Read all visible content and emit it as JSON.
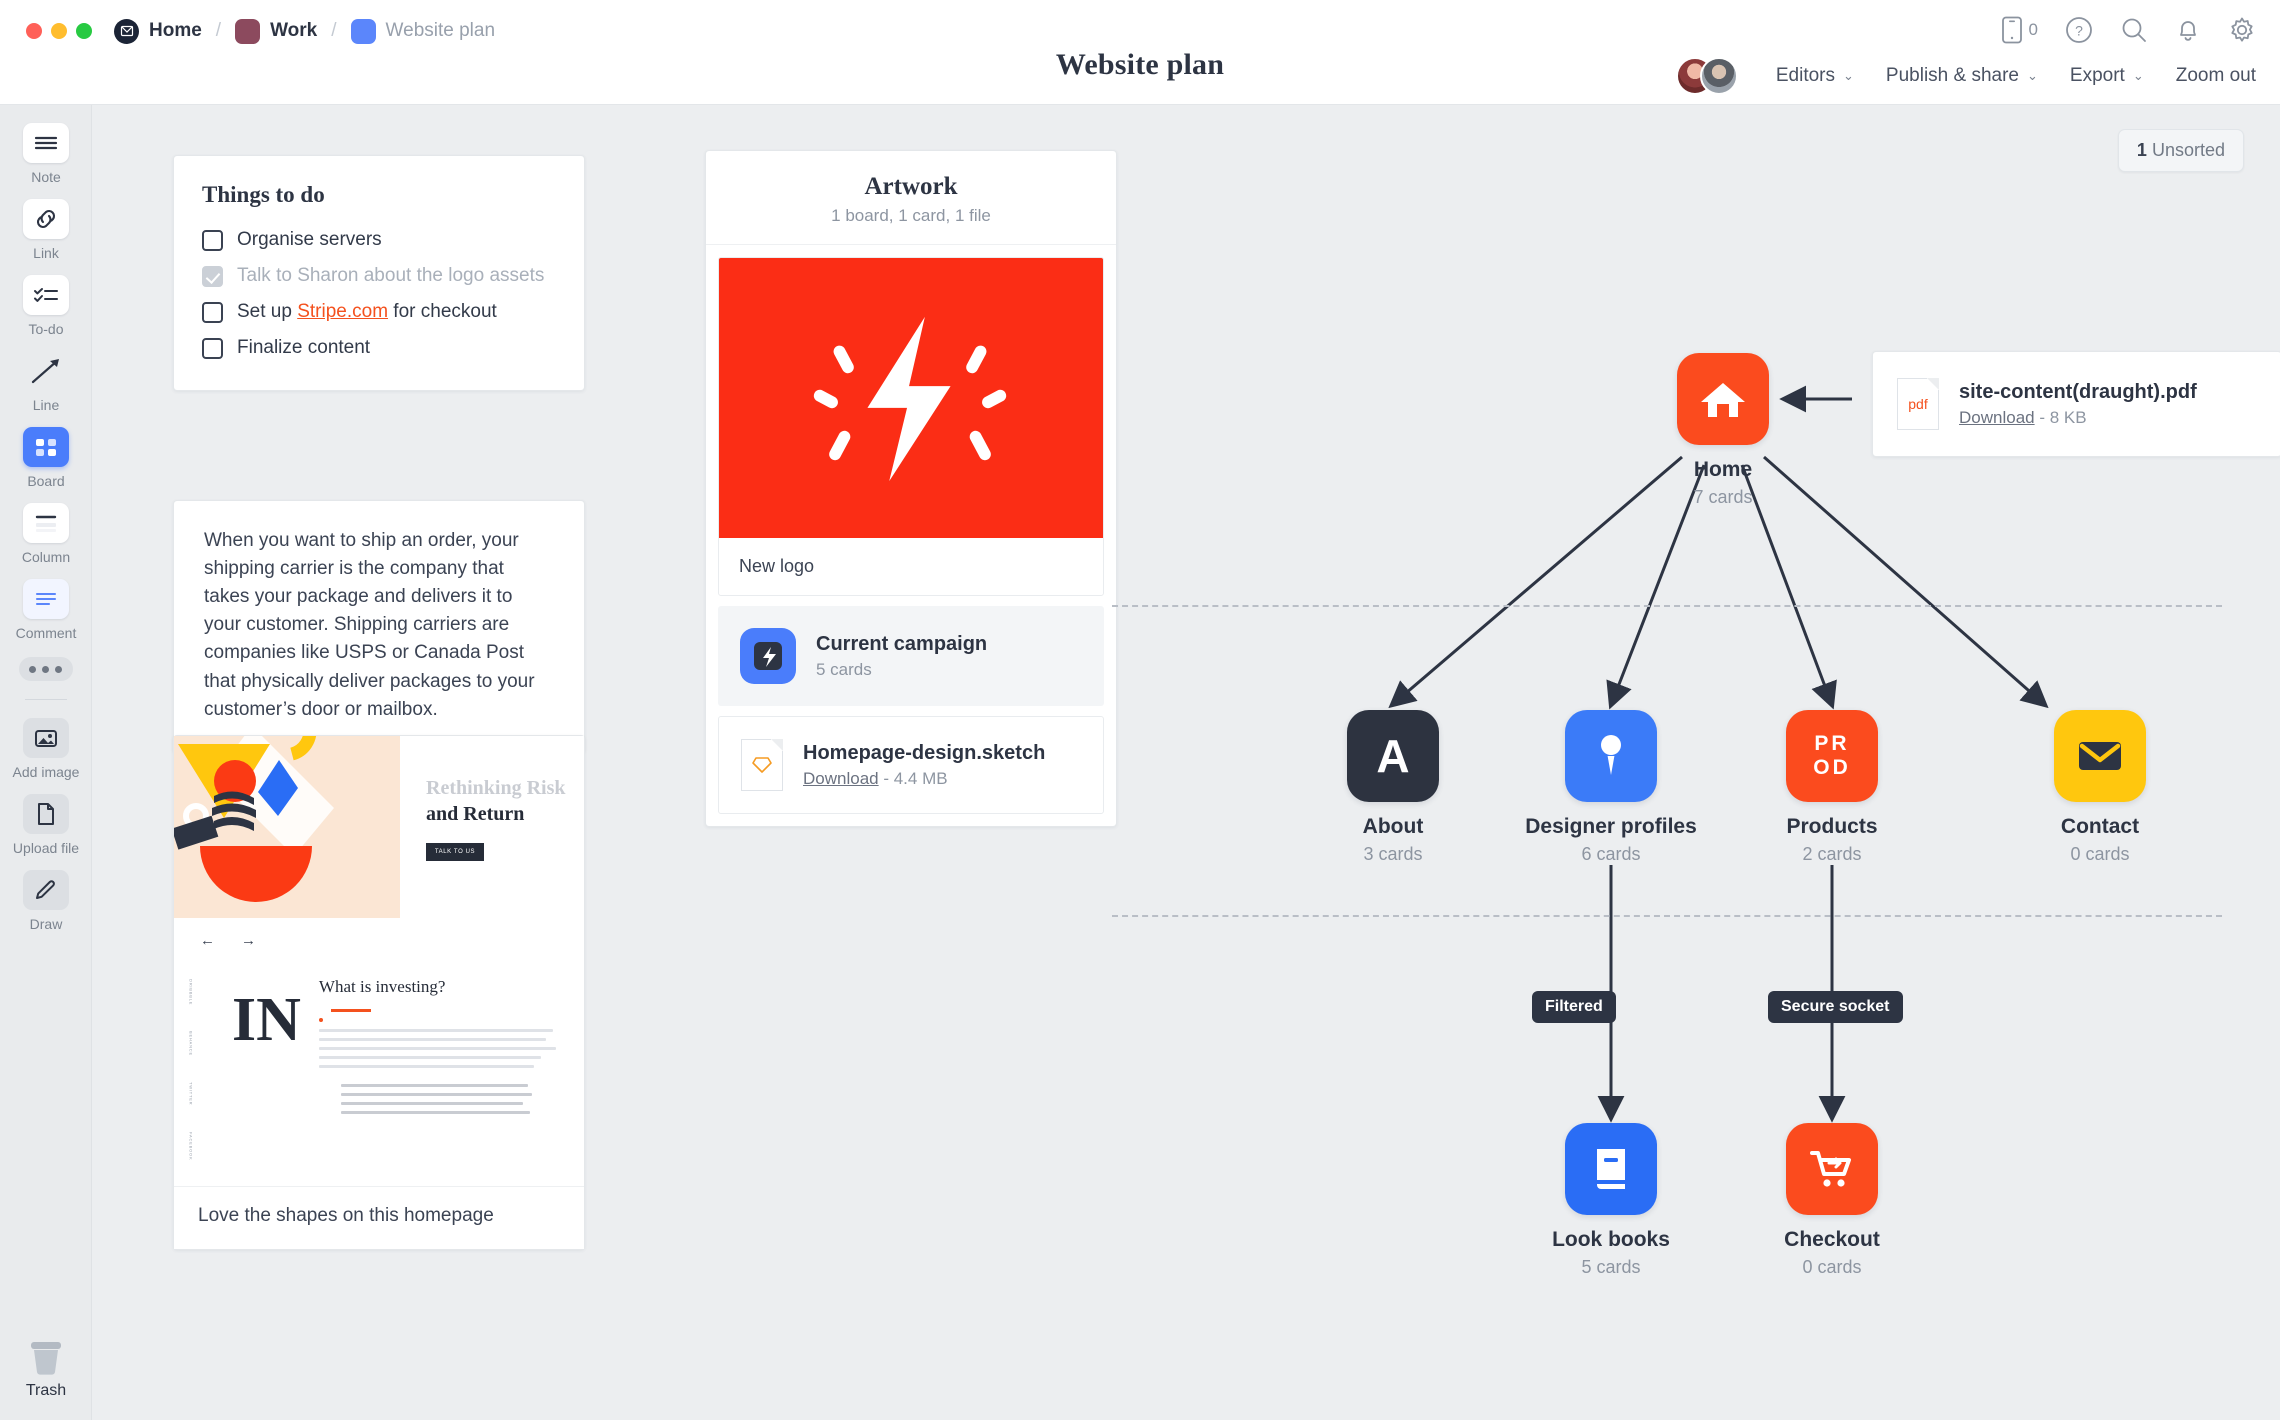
{
  "window": {
    "traffic_lights": [
      "close",
      "minimize",
      "zoom"
    ],
    "breadcrumb": [
      {
        "label": "Home",
        "icon": "milanote-logo-icon",
        "color": "#1b2436"
      },
      {
        "label": "Work",
        "icon": "color-swatch-icon",
        "color": "#8c4a5e"
      },
      {
        "label": "Website plan",
        "icon": "color-swatch-icon",
        "color": "#5b86fb"
      }
    ],
    "separator": "/",
    "title": "Website plan"
  },
  "topbar_icons": [
    {
      "name": "mobile-device-icon",
      "badge": "0"
    },
    {
      "name": "help-icon"
    },
    {
      "name": "search-icon"
    },
    {
      "name": "notifications-bell-icon"
    },
    {
      "name": "settings-gear-icon"
    }
  ],
  "topbar_actions": [
    {
      "label": "Editors",
      "caret": "⌄"
    },
    {
      "label": "Publish & share",
      "caret": "⌄"
    },
    {
      "label": "Export",
      "caret": "⌄"
    },
    {
      "label": "Zoom out",
      "caret": ""
    }
  ],
  "toolbar": {
    "items": [
      {
        "label": "Note",
        "icon": "note-icon",
        "selected": false
      },
      {
        "label": "Link",
        "icon": "link-icon",
        "selected": false
      },
      {
        "label": "To-do",
        "icon": "todo-list-icon",
        "selected": false
      },
      {
        "label": "Line",
        "icon": "line-arrow-icon",
        "selected": false
      },
      {
        "label": "Board",
        "icon": "board-icon",
        "selected": true
      },
      {
        "label": "Column",
        "icon": "column-icon",
        "selected": false
      },
      {
        "label": "Comment",
        "icon": "comment-icon",
        "selected": false
      }
    ],
    "more_label": "…",
    "upload_items": [
      {
        "label": "Add image",
        "icon": "add-image-icon"
      },
      {
        "label": "Upload file",
        "icon": "upload-file-icon"
      },
      {
        "label": "Draw",
        "icon": "draw-pencil-icon"
      }
    ],
    "trash_label": "Trash"
  },
  "canvas": {
    "unsorted_badge": {
      "count": "1",
      "label": "Unsorted"
    },
    "todo_card": {
      "title": "Things to do",
      "items": [
        {
          "text": "Organise servers",
          "done": false
        },
        {
          "text": "Talk to Sharon about the logo assets",
          "done": true
        },
        {
          "text_before": "Set up ",
          "link": "Stripe.com",
          "text_after": " for checkout",
          "done": false
        },
        {
          "text": "Finalize content",
          "done": false
        }
      ]
    },
    "note_card": {
      "text": "When you want to ship an order, your shipping carrier is the company that takes your package and delivers it to your customer. Shipping carriers are companies like USPS or Canada Post that physically deliver packages to your customer’s door or mailbox."
    },
    "image_card": {
      "caption": "Love the shapes on this homepage",
      "screenshot": {
        "headline_grey": "Rethinking Risk",
        "headline_dark": "and Return",
        "button": "TALK TO US",
        "nav_back": "←",
        "nav_forward": "→",
        "section_heading": "What is investing?",
        "big_word": "IN",
        "rail": [
          "DRIBBBLE",
          "BEHANCE",
          "TWITTER",
          "FACEBOOK"
        ]
      }
    },
    "artwork_board": {
      "title": "Artwork",
      "subtitle": "1 board, 1 card, 1 file",
      "logo_caption": "New logo",
      "items": [
        {
          "title": "Current campaign",
          "subtitle": "5 cards",
          "icon": "board-thumbnail-icon",
          "color": "#4a7dfb"
        },
        {
          "title": "Homepage-design.sketch",
          "download": "Download",
          "size": "- 4.4 MB",
          "icon": "sketch-file-icon"
        }
      ]
    },
    "pdf_card": {
      "title": "site-content(draught).pdf",
      "download": "Download",
      "size": "- 8 KB",
      "icon": "pdf-file-icon",
      "icon_label": "pdf"
    },
    "sitemap": {
      "nodes": [
        {
          "id": "home",
          "name": "Home",
          "count": "7 cards",
          "icon": "house-icon",
          "color": "#fb4b1e"
        },
        {
          "id": "about",
          "name": "About",
          "count": "3 cards",
          "icon": "letter-a-icon",
          "color": "#2d3340"
        },
        {
          "id": "designer",
          "name": "Designer profiles",
          "count": "6 cards",
          "icon": "pin-icon",
          "color": "#3b7bf8"
        },
        {
          "id": "products",
          "name": "Products",
          "count": "2 cards",
          "icon": "prod-text-icon",
          "color": "#fb4b1e"
        },
        {
          "id": "contact",
          "name": "Contact",
          "count": "0 cards",
          "icon": "envelope-icon",
          "color": "#ffc70e"
        },
        {
          "id": "lookbooks",
          "name": "Look books",
          "count": "5 cards",
          "icon": "book-icon",
          "color": "#2a6df5"
        },
        {
          "id": "checkout",
          "name": "Checkout",
          "count": "0 cards",
          "icon": "shopping-cart-icon",
          "color": "#fb4b1e"
        }
      ],
      "edge_labels": [
        {
          "id": "filtered",
          "label": "Filtered"
        },
        {
          "id": "secure",
          "label": "Secure socket"
        }
      ]
    }
  },
  "colors": {
    "accent_blue": "#4a7dfb",
    "accent_orange": "#fb4b1e",
    "accent_yellow": "#ffc70e",
    "dark": "#2d3443",
    "canvas_bg": "#eceef0",
    "link_orange": "#f4511e"
  }
}
